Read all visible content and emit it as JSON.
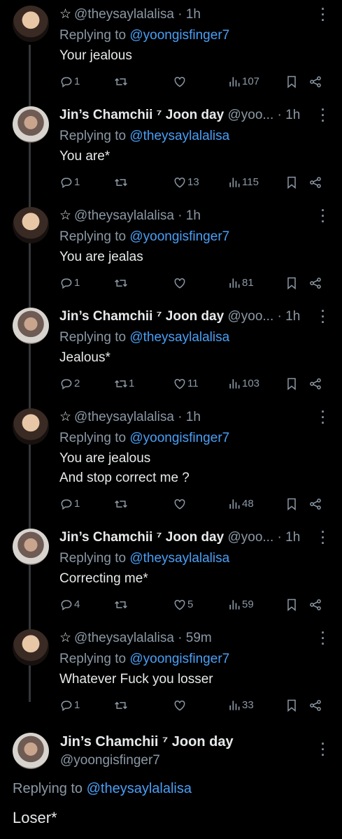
{
  "tweets": [
    {
      "star": "☆",
      "handle": "@theysaylalalisa",
      "time": "· 1h",
      "replying_prefix": "Replying to ",
      "replying_to": "@yoongisfinger7",
      "text": "Your jealous",
      "replies": "1",
      "retweets": "",
      "likes": "",
      "views": "107"
    },
    {
      "name": "Jin’s Chamchii ⁷ Joon day",
      "handle": "@yoo...",
      "time": "· 1h",
      "replying_prefix": "Replying to ",
      "replying_to": "@theysaylalalisa",
      "text": "You are*",
      "replies": "1",
      "retweets": "",
      "likes": "13",
      "views": "115"
    },
    {
      "star": "☆",
      "handle": "@theysaylalalisa",
      "time": "· 1h",
      "replying_prefix": "Replying to ",
      "replying_to": "@yoongisfinger7",
      "text": "You are jealas",
      "replies": "1",
      "retweets": "",
      "likes": "",
      "views": "81"
    },
    {
      "name": "Jin’s Chamchii ⁷ Joon day",
      "handle": "@yoo...",
      "time": "· 1h",
      "replying_prefix": "Replying to ",
      "replying_to": "@theysaylalalisa",
      "text": "Jealous*",
      "replies": "2",
      "retweets": "1",
      "likes": "11",
      "views": "103"
    },
    {
      "star": "☆",
      "handle": "@theysaylalalisa",
      "time": "· 1h",
      "replying_prefix": "Replying to ",
      "replying_to": "@yoongisfinger7",
      "text": "You are jealous\nAnd stop correct me ?",
      "replies": "1",
      "retweets": "",
      "likes": "",
      "views": "48"
    },
    {
      "name": "Jin’s Chamchii ⁷ Joon day",
      "handle": "@yoo...",
      "time": "· 1h",
      "replying_prefix": "Replying to ",
      "replying_to": "@theysaylalalisa",
      "text": "Correcting me*",
      "replies": "4",
      "retweets": "",
      "likes": "5",
      "views": "59"
    },
    {
      "star": "☆",
      "handle": "@theysaylalalisa",
      "time": "· 59m",
      "replying_prefix": "Replying to ",
      "replying_to": "@yoongisfinger7",
      "text": "Whatever Fuck you losser",
      "replies": "1",
      "retweets": "",
      "likes": "",
      "views": "33"
    }
  ],
  "main": {
    "name": "Jin’s Chamchii ⁷ Joon day",
    "handle": "@yoongisfinger7",
    "replying_prefix": "Replying to ",
    "replying_to": "@theysaylalalisa",
    "text": "Loser*"
  },
  "colors": {
    "background": "#000000",
    "text": "#e7e9ea",
    "muted": "#8b98a5",
    "link": "#4a9ff5"
  }
}
